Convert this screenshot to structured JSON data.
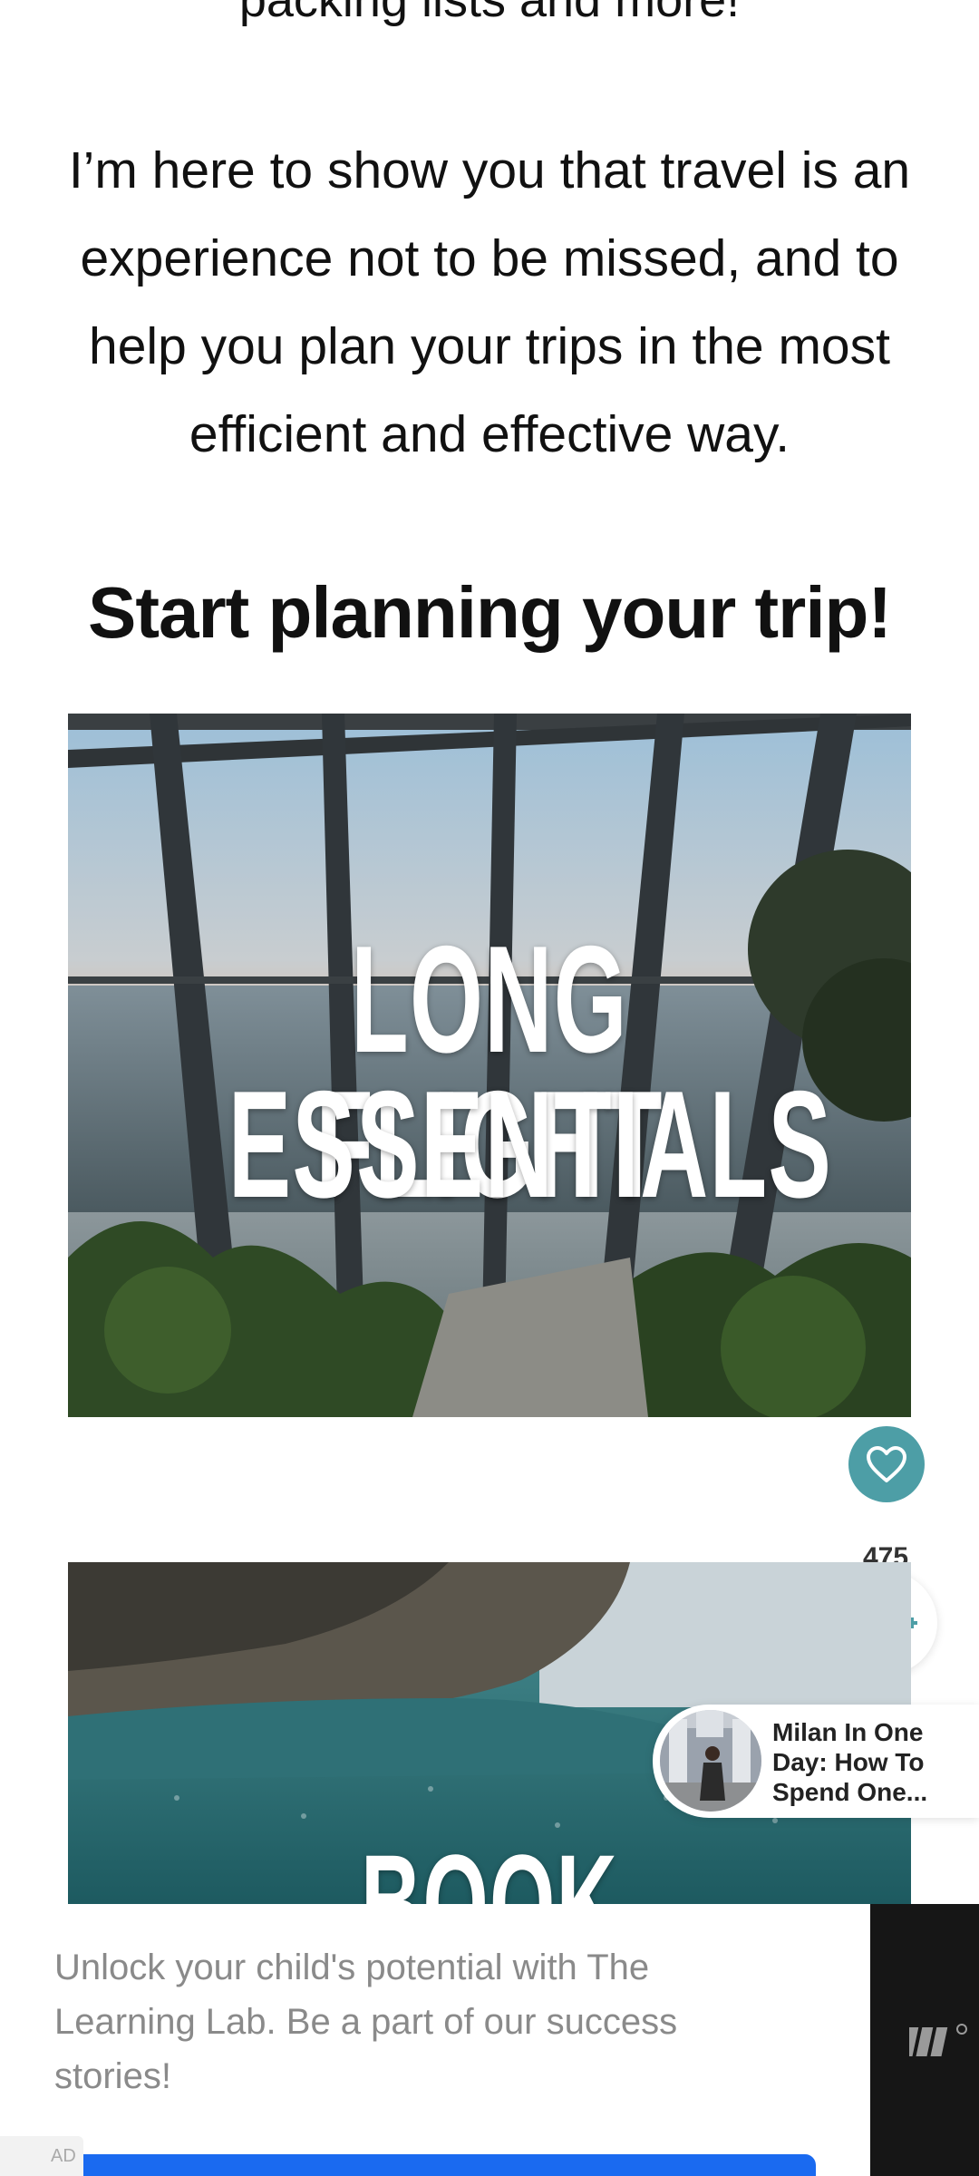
{
  "intro": {
    "clipped_line": "packing lists and more!",
    "paragraph": "I’m here to show you that travel is an experience not to be missed, and to help you plan your trips in the most efficient and effective way."
  },
  "section": {
    "heading": "Start planning your trip!"
  },
  "cards": [
    {
      "title_line1": "LONG FLIGHT",
      "title_line2": "ESSENTIALS"
    },
    {
      "title_line1": "BOOK YOUR TRIP"
    }
  ],
  "social": {
    "share_count": "475",
    "icons": {
      "like": "heart-icon",
      "share": "share-icon"
    },
    "accent_color": "#4d9ea6"
  },
  "related_post": {
    "title": "Milan In One Day: How To Spend One..."
  },
  "ad": {
    "text": "Unlock your child's potential with The Learning Lab. Be a part of our success stories!",
    "badge": "AD",
    "cta_color": "#1a6af0"
  }
}
